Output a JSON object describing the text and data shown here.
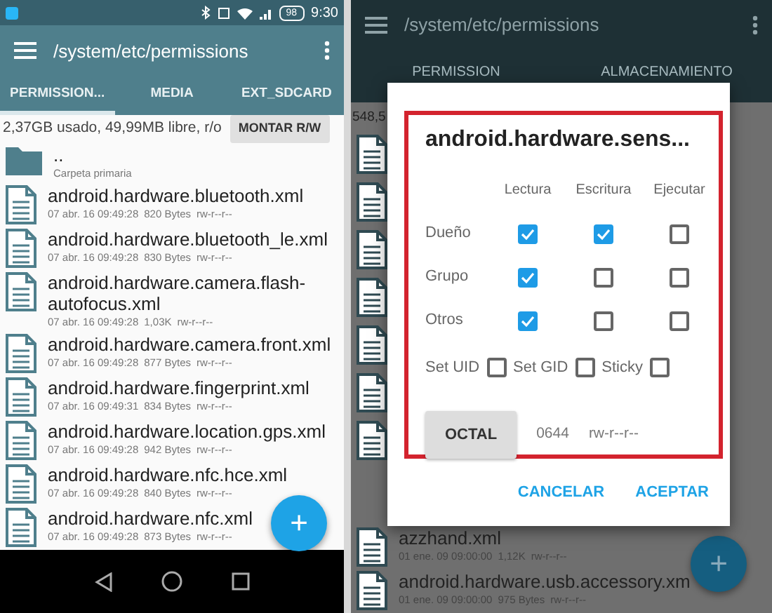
{
  "left": {
    "status_bar": {
      "battery": "98",
      "time": "9:30"
    },
    "toolbar": {
      "title": "/system/etc/permissions"
    },
    "tabs": [
      {
        "label": "PERMISSION...",
        "selected": true
      },
      {
        "label": "MEDIA",
        "selected": false
      },
      {
        "label": "EXT_SDCARD",
        "selected": false
      }
    ],
    "storage": {
      "text": "2,37GB usado, 49,99MB libre, r/o",
      "button": "MONTAR R/W"
    },
    "files": [
      {
        "kind": "folder",
        "name": "..",
        "meta": "Carpeta primaria"
      },
      {
        "kind": "file",
        "name": "android.hardware.bluetooth.xml",
        "date": "07 abr. 16 09:49:28",
        "size": "820 Bytes",
        "perms": "rw-r--r--"
      },
      {
        "kind": "file",
        "name": "android.hardware.bluetooth_le.xml",
        "date": "07 abr. 16 09:49:28",
        "size": "830 Bytes",
        "perms": "rw-r--r--"
      },
      {
        "kind": "file",
        "name": "android.hardware.camera.flash-autofocus.xml",
        "date": "07 abr. 16 09:49:28",
        "size": "1,03K",
        "perms": "rw-r--r--"
      },
      {
        "kind": "file",
        "name": "android.hardware.camera.front.xml",
        "date": "07 abr. 16 09:49:28",
        "size": "877 Bytes",
        "perms": "rw-r--r--"
      },
      {
        "kind": "file",
        "name": "android.hardware.fingerprint.xml",
        "date": "07 abr. 16 09:49:31",
        "size": "834 Bytes",
        "perms": "rw-r--r--"
      },
      {
        "kind": "file",
        "name": "android.hardware.location.gps.xml",
        "date": "07 abr. 16 09:49:28",
        "size": "942 Bytes",
        "perms": "rw-r--r--"
      },
      {
        "kind": "file",
        "name": "android.hardware.nfc.hce.xml",
        "date": "07 abr. 16 09:49:28",
        "size": "840 Bytes",
        "perms": "rw-r--r--"
      },
      {
        "kind": "file",
        "name": "android.hardware.nfc.xml",
        "date": "07 abr. 16 09:49:28",
        "size": "873 Bytes",
        "perms": "rw-r--r--"
      }
    ],
    "fab": {
      "label": "+"
    }
  },
  "right": {
    "toolbar": {
      "title": "/system/etc/permissions"
    },
    "tabs": [
      "PERMISSION",
      "ALMACENAMIENTO"
    ],
    "storage": {
      "text": "548,5"
    },
    "files": [
      {
        "name": "azzhand.xml",
        "date": "01 ene. 09 09:00:00",
        "size": "1,12K",
        "perms": "rw-r--r--"
      },
      {
        "name": "android.hardware.usb.accessory.xm",
        "date": "01 ene. 09 09:00:00",
        "size": "975 Bytes",
        "perms": "rw-r--r--"
      }
    ],
    "fab": {
      "label": "+"
    },
    "dialog": {
      "title": "android.hardware.sens...",
      "columns": [
        "Lectura",
        "Escritura",
        "Ejecutar"
      ],
      "rows": [
        {
          "label": "Dueño",
          "checks": [
            true,
            true,
            false
          ]
        },
        {
          "label": "Grupo",
          "checks": [
            true,
            false,
            false
          ]
        },
        {
          "label": "Otros",
          "checks": [
            true,
            false,
            false
          ]
        }
      ],
      "special": [
        {
          "label": "Set UID",
          "checked": false
        },
        {
          "label": "Set GID",
          "checked": false
        },
        {
          "label": "Sticky",
          "checked": false
        }
      ],
      "octal_button": "OCTAL",
      "octal": "0644",
      "perms": "rw-r--r--",
      "actions": [
        "CANCELAR",
        "ACEPTAR"
      ]
    }
  }
}
